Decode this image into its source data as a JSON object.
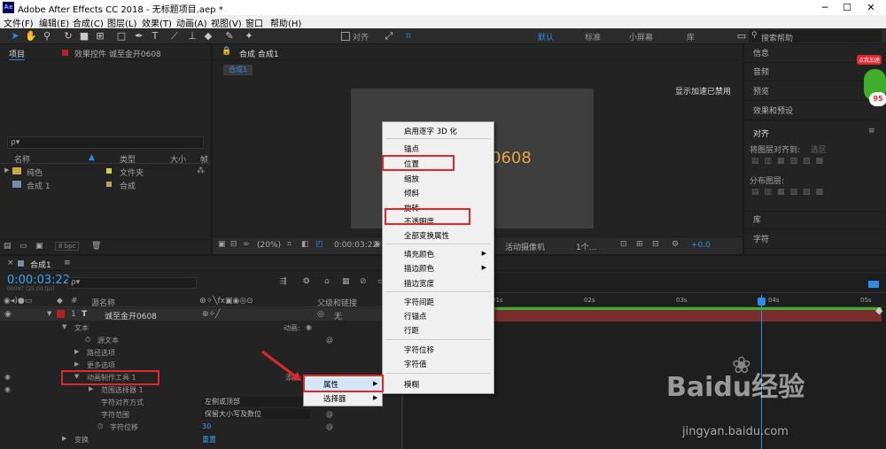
{
  "window": {
    "app_icon": "Ae",
    "title": "Adobe After Effects CC 2018 - 无标题项目.aep *",
    "minimize": "─",
    "maximize": "☐",
    "close": "✕"
  },
  "menu": [
    "文件(F)",
    "编辑(E)",
    "合成(C)",
    "图层(L)",
    "效果(T)",
    "动画(A)",
    "视图(V)",
    "窗口",
    "帮助(H)"
  ],
  "toolbar": {
    "align_label": "对齐",
    "workspaces": [
      "默认",
      "标准",
      "小屏幕",
      "库"
    ],
    "search_placeholder": "搜索帮助"
  },
  "project_panel": {
    "tab_project": "项目",
    "tab_effects": "效果控件 诚至金开0608",
    "search_prefix": "ρ▾",
    "columns": {
      "name": "名称",
      "type": "类型",
      "size": "大小",
      "extra": "帧"
    },
    "items": [
      {
        "name": "纯色",
        "type": "文件夹"
      },
      {
        "name": "合成 1",
        "type": "合成"
      }
    ],
    "bpc": "8 bpc"
  },
  "comp_viewer": {
    "tab": "合成 合成1",
    "subtab": "合成1",
    "notice": "显示加速已禁用",
    "comp_text": "0608",
    "footer": {
      "zoom": "(20%)",
      "time": "0:00:03:22",
      "camera": "活动摄像机",
      "views": "1个...",
      "offset": "+0.0"
    }
  },
  "right_panel": {
    "items": [
      "信息",
      "音频",
      "预览",
      "效果和预设"
    ],
    "align": {
      "title": "对齐",
      "align_to": "将图层对齐到:",
      "align_to_value": "选区",
      "distribute": "分布图层:"
    },
    "lower_items": [
      "库",
      "字符"
    ],
    "badge": "点我加速",
    "badge_number": "95"
  },
  "timeline": {
    "tab": "合成1",
    "timecode": "0:00:03:22",
    "timecode_sub": "00097 (25.00 fps)",
    "search_prefix": "ρ▾",
    "col_source": "源名称",
    "col_parent": "父级和链接",
    "ruler": [
      "01s",
      "02s",
      "03s",
      "04s",
      "05s"
    ],
    "layer": {
      "num": "1",
      "name": "诚至金开0608",
      "parent": "无"
    },
    "rows": [
      {
        "label": "文本",
        "extra": "动画:"
      },
      {
        "label": "源文本"
      },
      {
        "label": "路径选项"
      },
      {
        "label": "更多选项"
      },
      {
        "label": "动画制作工具 1",
        "extra": "添加:"
      },
      {
        "label": "范围选择器 1"
      },
      {
        "label": "字符对齐方式",
        "value": "左侧或顶部"
      },
      {
        "label": "字符范围",
        "value": "保留大小写及数位"
      },
      {
        "label": "字符位移",
        "value": "30"
      },
      {
        "label": "变换",
        "value": "重置"
      }
    ]
  },
  "context_menu": {
    "items": [
      "启用逐字 3D 化",
      "锚点",
      "位置",
      "缩放",
      "倾斜",
      "旋转",
      "不透明度",
      "全部变换属性",
      "填充颜色",
      "描边颜色",
      "描边宽度",
      "字符间距",
      "行锚点",
      "行距",
      "字符位移",
      "字符值",
      "模糊"
    ]
  },
  "submenu": {
    "items": [
      "属性",
      "选择器"
    ]
  },
  "watermark": {
    "brand": "Baidu经验",
    "url": "jingyan.baidu.com"
  },
  "colors": {
    "accent": "#2d8ceb",
    "highlight_red": "#e3262c",
    "layer_red": "#b22222",
    "track_bar": "#7a2d2d",
    "text_orange": "#e5a63f"
  }
}
